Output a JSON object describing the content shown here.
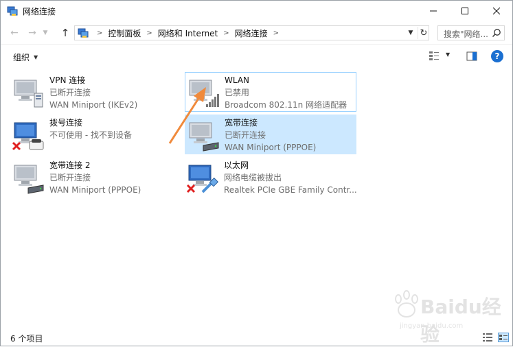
{
  "window": {
    "title": "网络连接"
  },
  "nav": {
    "breadcrumbs": [
      "控制面板",
      "网络和 Internet",
      "网络连接"
    ],
    "search_placeholder": "搜索\"网络..."
  },
  "toolbar": {
    "organize_label": "组织",
    "help_label": "?"
  },
  "connections": [
    {
      "name": "VPN 连接",
      "status": "已断开连接",
      "device": "WAN Miniport (IKEv2)",
      "icon": "vpn-connection-icon"
    },
    {
      "name": "WLAN",
      "status": "已禁用",
      "device": "Broadcom 802.11n 网络适配器",
      "icon": "wlan-connection-icon"
    },
    {
      "name": "拨号连接",
      "status": "不可使用 - 找不到设备",
      "device": "",
      "icon": "dialup-connection-icon"
    },
    {
      "name": "宽带连接",
      "status": "已断开连接",
      "device": "WAN Miniport (PPPOE)",
      "icon": "broadband-connection-icon"
    },
    {
      "name": "宽带连接 2",
      "status": "已断开连接",
      "device": "WAN Miniport (PPPOE)",
      "icon": "broadband-connection-icon"
    },
    {
      "name": "以太网",
      "status": "网络电缆被拔出",
      "device": "Realtek PCIe GBE Family Contr...",
      "icon": "ethernet-connection-icon"
    }
  ],
  "status_bar": {
    "count": "6 个项目"
  },
  "watermark": {
    "text": "Baidu经验",
    "sub": "jingyan.baidu.com"
  },
  "colors": {
    "selection": "#cce8ff",
    "focus_border": "#99d1ff",
    "annotation_arrow": "#f08a3c",
    "disconnect_x": "#e02020"
  }
}
